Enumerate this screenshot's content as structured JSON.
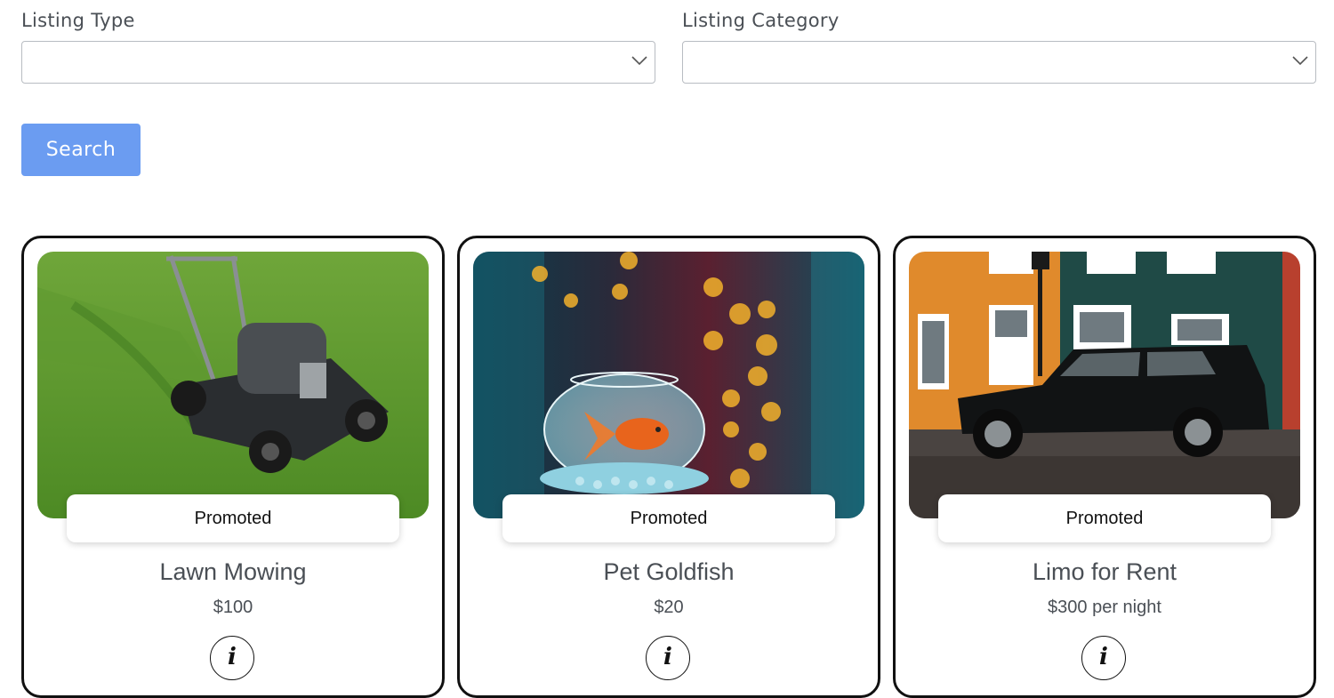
{
  "filters": {
    "listing_type": {
      "label": "Listing Type",
      "value": ""
    },
    "listing_category": {
      "label": "Listing Category",
      "value": ""
    }
  },
  "search": {
    "label": "Search",
    "color": "#6b9cf1"
  },
  "listings": [
    {
      "image": "lawn-mower-on-grass",
      "badge": "Promoted",
      "title": "Lawn Mowing",
      "price": "$100",
      "info_icon": "info-icon"
    },
    {
      "image": "goldfish-in-bowl",
      "badge": "Promoted",
      "title": "Pet Goldfish",
      "price": "$20",
      "info_icon": "info-icon"
    },
    {
      "image": "black-suv-on-street",
      "badge": "Promoted",
      "title": "Limo for Rent",
      "price": "$300 per night",
      "info_icon": "info-icon"
    }
  ],
  "icons": {
    "select_arrow": "chevron-down-icon",
    "info": "info-icon"
  },
  "colors": {
    "card_border": "#111111",
    "text": "#4a4f55"
  }
}
